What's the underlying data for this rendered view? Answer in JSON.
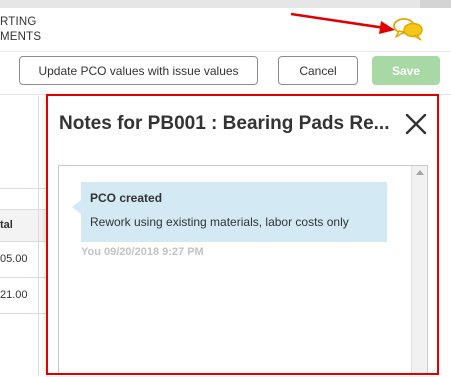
{
  "header": {
    "title_line1": "RTING",
    "title_line2": "MENTS",
    "chat_icon": "chat-bubbles-icon"
  },
  "toolbar": {
    "update_label": "Update PCO values with issue values",
    "cancel_label": "Cancel",
    "save_label": "Save"
  },
  "grid": {
    "header_label": "tal",
    "rows": [
      "05.00",
      "21.00"
    ]
  },
  "modal": {
    "title": "Notes for PB001 : Bearing Pads Re...",
    "close_icon": "close-icon",
    "notes": [
      {
        "title": "PCO created",
        "body": "Rework using existing materials, labor costs only",
        "meta": "You 09/20/2018 9:27 PM"
      }
    ]
  },
  "colors": {
    "save_button": "#a7d9a5",
    "note_background": "#d3e9f3",
    "annotation_red": "#e00000",
    "chat_icon": "#f5c518"
  }
}
